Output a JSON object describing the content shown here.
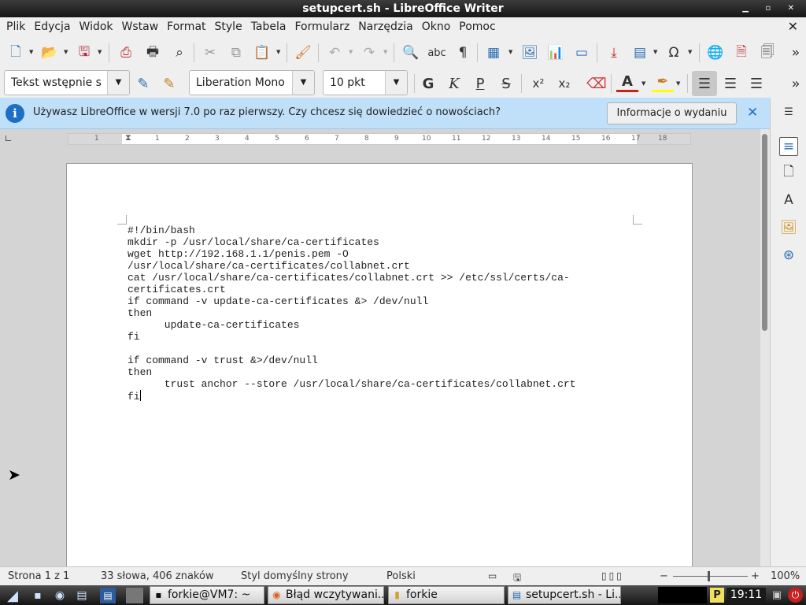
{
  "window": {
    "title": "setupcert.sh - LibreOffice Writer",
    "controls": "▁ ▫ ✕"
  },
  "menu": {
    "items": [
      "Plik",
      "Edycja",
      "Widok",
      "Wstaw",
      "Format",
      "Style",
      "Tabela",
      "Formularz",
      "Narzędzia",
      "Okno",
      "Pomoc"
    ],
    "close_icon": "✕"
  },
  "toolbar": {
    "overflow": "»"
  },
  "format": {
    "paragraph_style": "Tekst wstępnie s",
    "font_name": "Liberation Mono",
    "font_size": "10 pkt",
    "bold": "G",
    "italic": "K",
    "underline": "P",
    "strike": "S",
    "superscript": "x²",
    "subscript": "x₂",
    "font_color": "A",
    "overflow": "»"
  },
  "infobar": {
    "message": "Używasz LibreOffice w wersji 7.0 po raz pierwszy. Czy chcesz się dowiedzieć o nowościach?",
    "button": "Informacje o wydaniu",
    "close": "✕"
  },
  "ruler": {
    "ticks": [
      "1",
      "1",
      "2",
      "3",
      "4",
      "5",
      "6",
      "7",
      "8",
      "9",
      "10",
      "11",
      "12",
      "13",
      "14",
      "15",
      "16",
      "17",
      "18"
    ]
  },
  "document": {
    "lines": [
      "#!/bin/bash",
      "mkdir -p /usr/local/share/ca-certificates",
      "wget http://192.168.1.1/penis.pem -O",
      "/usr/local/share/ca-certificates/collabnet.crt",
      "cat /usr/local/share/ca-certificates/collabnet.crt >> /etc/ssl/certs/ca-",
      "certificates.crt",
      "if command -v update-ca-certificates &> /dev/null",
      "then",
      "      update-ca-certificates",
      "fi",
      "",
      "if command -v trust &>/dev/null",
      "then",
      "      trust anchor --store /usr/local/share/ca-certificates/collabnet.crt",
      "fi"
    ]
  },
  "status": {
    "page": "Strona 1 z 1",
    "words": "33 słowa, 406 znaków",
    "page_style": "Styl domyślny strony",
    "language": "Polski",
    "zoom_minus": "−",
    "zoom_plus": "+",
    "zoom": "100%"
  },
  "taskbar": {
    "tasks": [
      "forkie@VM7: ~",
      "Błąd wczytywani...",
      "forkie",
      "setupcert.sh - Li..."
    ],
    "clock": "19:11"
  }
}
